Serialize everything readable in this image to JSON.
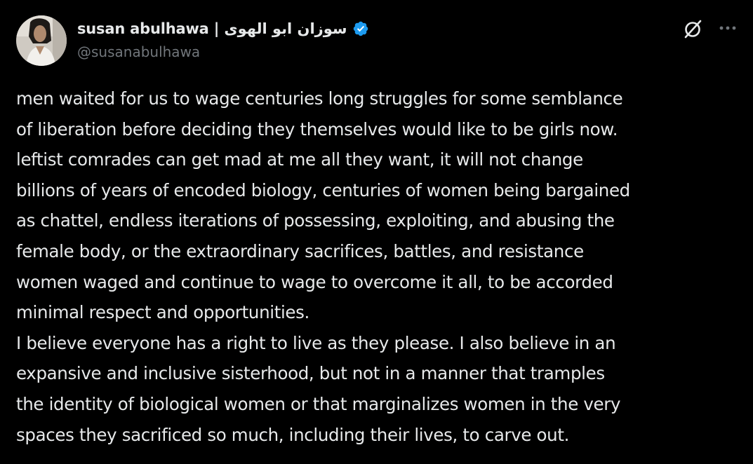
{
  "author": {
    "display_name": "susan abulhawa | سوزان ابو الهوى",
    "handle": "@susanabulhawa",
    "verified": true,
    "avatar_icon": "profile-photo-avatar"
  },
  "header_actions": {
    "grok_icon": "grok-slash-circle-icon",
    "more_icon": "more-horizontal-icon"
  },
  "tweet": {
    "lines": [
      "men waited for us to wage centuries long struggles for some semblance",
      "of liberation before deciding they themselves would like to be girls now.",
      "leftist comrades can get mad at me all they want, it will not change",
      "billions of years of encoded biology, centuries of women being bargained",
      "as chattel, endless iterations of possessing, exploiting, and abusing the",
      "female body, or the extraordinary sacrifices, battles, and resistance",
      "women waged and continue to wage to overcome it all, to be accorded",
      "minimal respect and opportunities.",
      "I believe everyone has a right to live as they please. I also believe in an",
      "expansive and inclusive sisterhood, but not in a manner that tramples",
      "the identity of biological women or that marginalizes women in the very",
      "spaces they sacrificed so much, including their lives, to carve out."
    ]
  },
  "colors": {
    "background": "#000000",
    "text_primary": "#e7e9ea",
    "text_secondary": "#71767b",
    "verified_blue": "#1d9bf0"
  }
}
